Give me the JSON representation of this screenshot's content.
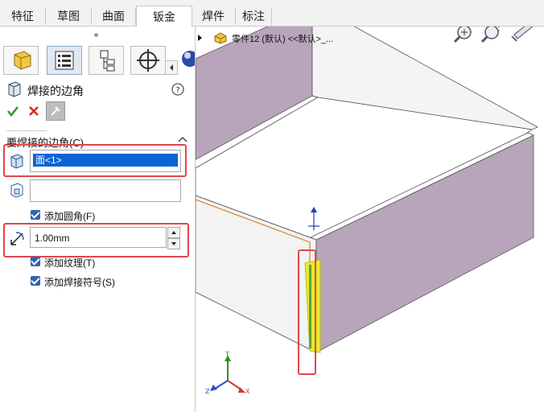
{
  "tabs": [
    "特征",
    "草图",
    "曲面",
    "钣金",
    "焊件",
    "标注"
  ],
  "active_tab": "钣金",
  "panel": {
    "title": "焊接的边角",
    "section_title": "要焊接的边角(C)",
    "face_value": "面<1>",
    "second_field_value": "",
    "add_fillet_label": "添加圆角(F)",
    "radius_value": "1.00mm",
    "add_texture_label": "添加纹理(T)",
    "add_weld_symbol_label": "添加焊接符号(S)"
  },
  "tree": {
    "item": "零件12 (默认) <<默认>_..."
  },
  "triad": {
    "x": "X",
    "y": "Y",
    "z": "Z"
  },
  "colors": {
    "wall": "#b8a5bb",
    "selection": "#0a64d6",
    "highlight": "#e8ea2c",
    "callout": "#e0474c"
  }
}
